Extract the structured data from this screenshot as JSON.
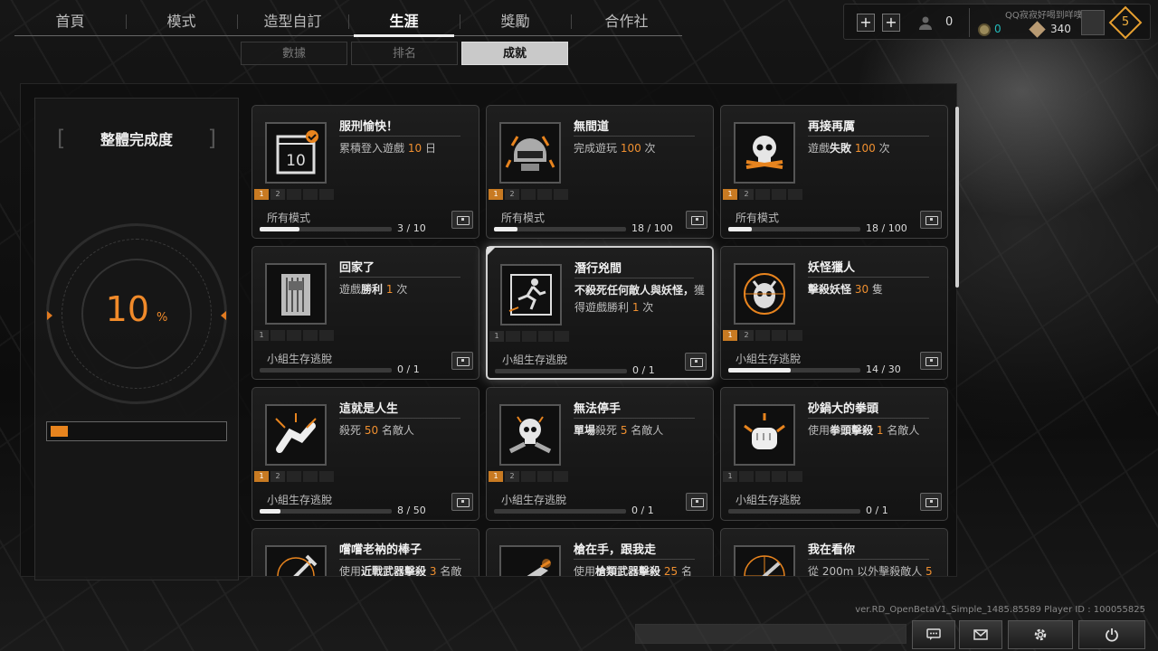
{
  "top_nav": {
    "tabs": [
      "首頁",
      "模式",
      "造型自訂",
      "生涯",
      "獎勵",
      "合作社"
    ],
    "active": "生涯"
  },
  "sub_tabs": {
    "tabs": [
      "數據",
      "排名",
      "成就"
    ],
    "active": "成就"
  },
  "player": {
    "username": "QQ寂寂好喝到咩噗茶",
    "friends_count": "0",
    "currency_teal": "0",
    "currency_gold": "340",
    "level": "5"
  },
  "overview": {
    "title": "整體完成度",
    "percent": "10",
    "percent_sign": "%",
    "progress_fraction": 0.1
  },
  "cards": [
    {
      "title": "服刑愉快！",
      "desc": [
        {
          "t": "累積登入"
        },
        {
          "t": "遊戲 "
        },
        {
          "t": "10",
          "e": 1
        },
        {
          "t": " 日"
        }
      ],
      "icon": "calendar-icon",
      "icon_text": "10",
      "tiers": [
        "1",
        "2",
        "",
        "",
        ""
      ],
      "on": 1,
      "mode": "所有模式",
      "progress": "3 / 10",
      "fill": 0.3
    },
    {
      "title": "無間道",
      "desc": [
        {
          "t": "完成遊玩 "
        },
        {
          "t": "100",
          "e": 1
        },
        {
          "t": " 次"
        }
      ],
      "icon": "helmet-icon",
      "tiers": [
        "1",
        "2",
        "",
        "",
        ""
      ],
      "on": 1,
      "mode": "所有模式",
      "progress": "18 / 100",
      "fill": 0.18
    },
    {
      "title": "再接再厲",
      "desc": [
        {
          "t": "遊戲"
        },
        {
          "t": "失敗",
          "b": 1
        },
        {
          "t": " "
        },
        {
          "t": "100",
          "e": 1
        },
        {
          "t": " 次"
        }
      ],
      "icon": "skull-crossbones-icon",
      "tiers": [
        "1",
        "2",
        "",
        "",
        ""
      ],
      "on": 1,
      "mode": "所有模式",
      "progress": "18 / 100",
      "fill": 0.18
    },
    {
      "title": "回家了",
      "desc": [
        {
          "t": "遊戲"
        },
        {
          "t": "勝利",
          "b": 1
        },
        {
          "t": " "
        },
        {
          "t": "1",
          "e": 1
        },
        {
          "t": " 次"
        }
      ],
      "icon": "prison-door-icon",
      "tiers": [
        "1",
        "",
        "",
        "",
        ""
      ],
      "on": 0,
      "mode": "小組生存逃脫",
      "progress": "0 / 1",
      "fill": 0
    },
    {
      "title": "潛行兇間",
      "desc": [
        {
          "t": "不殺死任何敵人與妖怪，",
          "b": 1
        },
        {
          "t": "獲得遊戲勝利 "
        },
        {
          "t": "1",
          "e": 1
        },
        {
          "t": " 次"
        }
      ],
      "icon": "running-man-icon",
      "tiers": [
        "1",
        "",
        "",
        "",
        ""
      ],
      "on": 0,
      "mode": "小組生存逃脫",
      "progress": "0 / 1",
      "fill": 0,
      "highlight": true
    },
    {
      "title": "妖怪獵人",
      "desc": [
        {
          "t": "擊殺妖怪",
          "b": 1
        },
        {
          "t": " "
        },
        {
          "t": "30",
          "e": 1
        },
        {
          "t": " 隻"
        }
      ],
      "icon": "demon-skull-icon",
      "tiers": [
        "1",
        "2",
        "",
        "",
        ""
      ],
      "on": 1,
      "mode": "小組生存逃脫",
      "progress": "14 / 30",
      "fill": 0.47
    },
    {
      "title": "這就是人生",
      "desc": [
        {
          "t": "殺死 "
        },
        {
          "t": "50",
          "e": 1
        },
        {
          "t": " 名敵人"
        }
      ],
      "icon": "fallen-hand-icon",
      "tiers": [
        "1",
        "2",
        "",
        "",
        ""
      ],
      "on": 1,
      "mode": "小組生存逃脫",
      "progress": "8 / 50",
      "fill": 0.16
    },
    {
      "title": "無法停手",
      "desc": [
        {
          "t": "單場",
          "b": 1
        },
        {
          "t": "殺死 "
        },
        {
          "t": "5",
          "e": 1
        },
        {
          "t": " 名敵人"
        }
      ],
      "icon": "skull-guns-icon",
      "tiers": [
        "1",
        "2",
        "",
        "",
        ""
      ],
      "on": 1,
      "mode": "小組生存逃脫",
      "progress": "0 / 1",
      "fill": 0
    },
    {
      "title": "砂鍋大的拳頭",
      "desc": [
        {
          "t": "使用"
        },
        {
          "t": "拳頭擊殺",
          "b": 1
        },
        {
          "t": " "
        },
        {
          "t": "1",
          "e": 1
        },
        {
          "t": " 名敵人"
        }
      ],
      "icon": "fist-icon",
      "tiers": [
        "1",
        "",
        "",
        "",
        ""
      ],
      "on": 0,
      "mode": "小組生存逃脫",
      "progress": "0 / 1",
      "fill": 0
    },
    {
      "title": "嚐嚐老衲的棒子",
      "desc": [
        {
          "t": "使用"
        },
        {
          "t": "近戰武器擊殺",
          "b": 1
        },
        {
          "t": " "
        },
        {
          "t": "3",
          "e": 1
        },
        {
          "t": " 名敵"
        }
      ],
      "icon": "melee-weapon-icon",
      "tiers": [],
      "on": 0,
      "mode": "",
      "progress": "",
      "fill": 0
    },
    {
      "title": "槍在手，跟我走",
      "desc": [
        {
          "t": "使用"
        },
        {
          "t": "槍類武器擊殺",
          "b": 1
        },
        {
          "t": " "
        },
        {
          "t": "25",
          "e": 1
        },
        {
          "t": " 名"
        }
      ],
      "icon": "gun-icon",
      "tiers": [],
      "on": 0,
      "mode": "",
      "progress": "",
      "fill": 0
    },
    {
      "title": "我在看你",
      "desc": [
        {
          "t": "從 200m 以外擊殺敵人 "
        },
        {
          "t": "5",
          "e": 1
        }
      ],
      "icon": "sniper-scope-icon",
      "tiers": [],
      "on": 0,
      "mode": "",
      "progress": "",
      "fill": 0
    }
  ],
  "footer": {
    "version": "ver.RD_OpenBetaV1_Simple_1485.85589   Player ID : 100055825"
  },
  "colors": {
    "accent": "#f08a2a",
    "tier_on": "#c87a22"
  }
}
